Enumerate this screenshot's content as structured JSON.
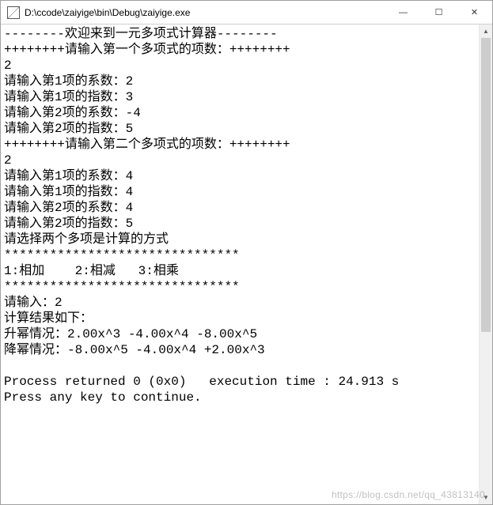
{
  "window": {
    "title": "D:\\ccode\\zaiyige\\bin\\Debug\\zaiyige.exe"
  },
  "console": {
    "lines": [
      "--------欢迎来到一元多项式计算器--------",
      "++++++++请输入第一个多项式的项数：++++++++",
      "2",
      "请输入第1项的系数：2",
      "请输入第1项的指数：3",
      "请输入第2项的系数：-4",
      "请输入第2项的指数：5",
      "++++++++请输入第二个多项式的项数：++++++++",
      "2",
      "请输入第1项的系数：4",
      "请输入第1项的指数：4",
      "请输入第2项的系数：4",
      "请输入第2项的指数：5",
      "请选择两个多项是计算的方式",
      "*******************************",
      "1:相加    2:相减   3:相乘",
      "*******************************",
      "请输入：2",
      "计算结果如下：",
      "升幂情况：2.00x^3 -4.00x^4 -8.00x^5",
      "降幂情况：-8.00x^5 -4.00x^4 +2.00x^3",
      "",
      "Process returned 0 (0x0)   execution time : 24.913 s",
      "Press any key to continue.",
      ""
    ]
  },
  "controls": {
    "minimize": "—",
    "maximize": "☐",
    "close": "✕",
    "scroll_up": "▲",
    "scroll_down": "▼"
  },
  "watermark": "https://blog.csdn.net/qq_43813140"
}
